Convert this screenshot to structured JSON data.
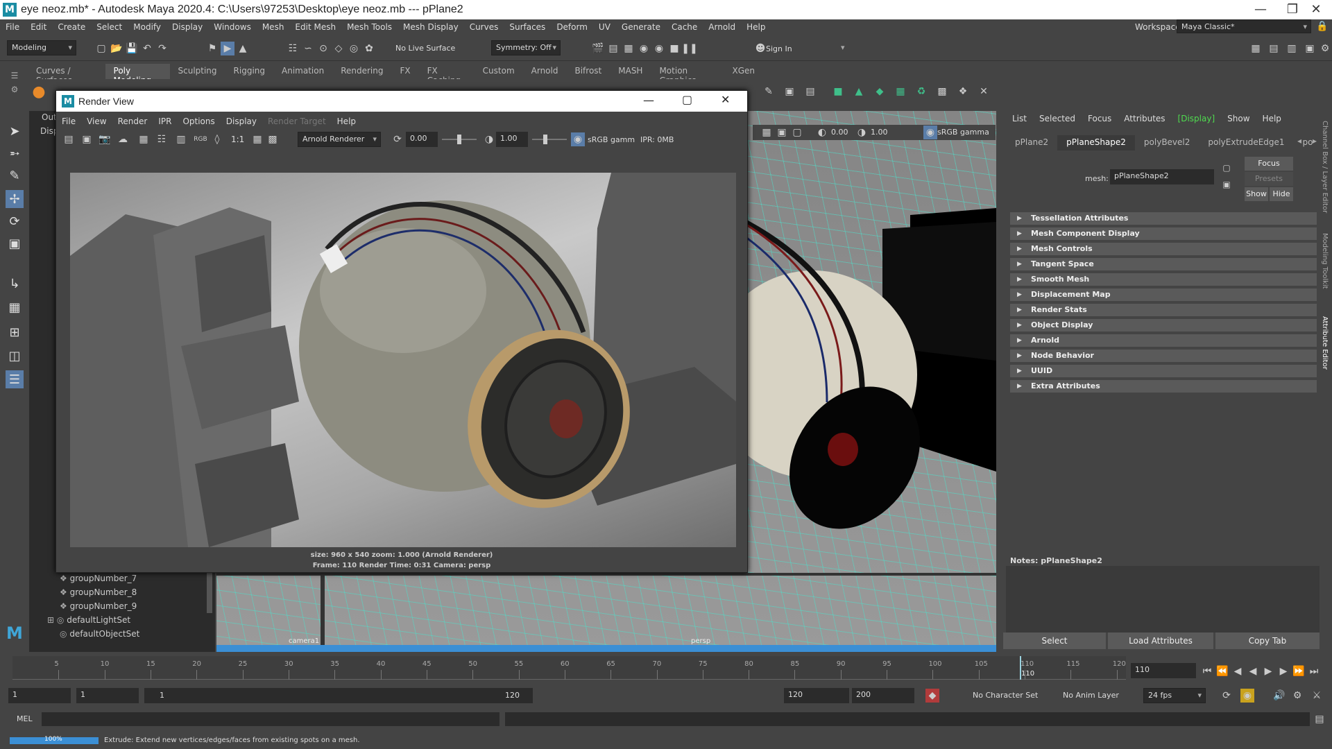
{
  "window": {
    "title": "eye neoz.mb* - Autodesk Maya 2020.4: C:\\Users\\97253\\Desktop\\eye neoz.mb   ---   pPlane2"
  },
  "menubar": [
    "File",
    "Edit",
    "Create",
    "Select",
    "Modify",
    "Display",
    "Windows",
    "Mesh",
    "Edit Mesh",
    "Mesh Tools",
    "Mesh Display",
    "Curves",
    "Surfaces",
    "Deform",
    "UV",
    "Generate",
    "Cache",
    "Arnold",
    "Help"
  ],
  "toolbar": {
    "mode": "Modeling",
    "live_surface": "No Live Surface",
    "symmetry": "Symmetry: Off",
    "sign_in": "Sign In",
    "workspace_label": "Workspace :",
    "workspace": "Maya Classic*"
  },
  "shelf_tabs": [
    "Curves / Surfaces",
    "Poly Modeling",
    "Sculpting",
    "Rigging",
    "Animation",
    "Rendering",
    "FX",
    "FX Caching",
    "Custom",
    "Arnold",
    "Bifrost",
    "MASH",
    "Motion Graphics",
    "XGen"
  ],
  "shelf_active": "Poly Modeling",
  "outliner": {
    "cut": [
      "Out",
      "Disp"
    ],
    "items": [
      "groupNumber_7",
      "groupNumber_8",
      "groupNumber_9",
      "defaultLightSet",
      "defaultObjectSet"
    ]
  },
  "viewport": {
    "bar_values": [
      "0.00",
      "1.00"
    ],
    "colorspace": "sRGB gamma",
    "cameras": [
      "camera1",
      "persp"
    ]
  },
  "render_view": {
    "title": "Render View",
    "menu": [
      "File",
      "View",
      "Render",
      "IPR",
      "Options",
      "Display",
      "Render Target",
      "Help"
    ],
    "disabled_menu": "Render Target",
    "ratio": "1:1",
    "renderer": "Arnold Renderer",
    "exposure": "0.00",
    "gamma": "1.00",
    "colorspace": "sRGB gamm",
    "ipr": "IPR: 0MB",
    "info_line1": "size: 960 x 540  zoom: 1.000       (Arnold Renderer)",
    "info_line2": "Frame: 110       Render Time: 0:31       Camera: persp"
  },
  "attribute_editor": {
    "menu": [
      "List",
      "Selected",
      "Focus",
      "Attributes",
      "[Display]",
      "Show",
      "Help"
    ],
    "tabs": [
      "pPlane2",
      "pPlaneShape2",
      "polyBevel2",
      "polyExtrudeEdge1",
      "po"
    ],
    "active_tab": "pPlaneShape2",
    "mesh_label": "mesh:",
    "mesh_value": "pPlaneShape2",
    "focus": "Focus",
    "presets": "Presets",
    "show": "Show",
    "hide": "Hide",
    "sections": [
      "Tessellation Attributes",
      "Mesh Component Display",
      "Mesh Controls",
      "Tangent Space",
      "Smooth Mesh",
      "Displacement Map",
      "Render Stats",
      "Object Display",
      "Arnold",
      "Node Behavior",
      "UUID",
      "Extra Attributes"
    ],
    "notes": "Notes:  pPlaneShape2",
    "buttons": [
      "Select",
      "Load Attributes",
      "Copy Tab"
    ]
  },
  "side_tabs": [
    "Channel Box / Layer Editor",
    "Modeling Toolkit",
    "Attribute Editor"
  ],
  "timeline": {
    "ticks": [
      "5",
      "10",
      "15",
      "20",
      "25",
      "30",
      "35",
      "40",
      "45",
      "50",
      "55",
      "60",
      "65",
      "70",
      "75",
      "80",
      "85",
      "90",
      "95",
      "100",
      "105",
      "110",
      "115",
      "120"
    ],
    "current": "110",
    "current_field": "110"
  },
  "range": {
    "start": "1",
    "start2": "1",
    "slider_start": "1",
    "slider_end": "120",
    "end": "120",
    "end2": "200",
    "character_set": "No Character Set",
    "anim_layer": "No Anim Layer",
    "fps": "24 fps"
  },
  "mel": {
    "label": "MEL"
  },
  "help": {
    "progress_text": "100%",
    "progress_value": 1.0,
    "message": "Extrude: Extend new vertices/edges/faces from existing spots on a mesh."
  }
}
